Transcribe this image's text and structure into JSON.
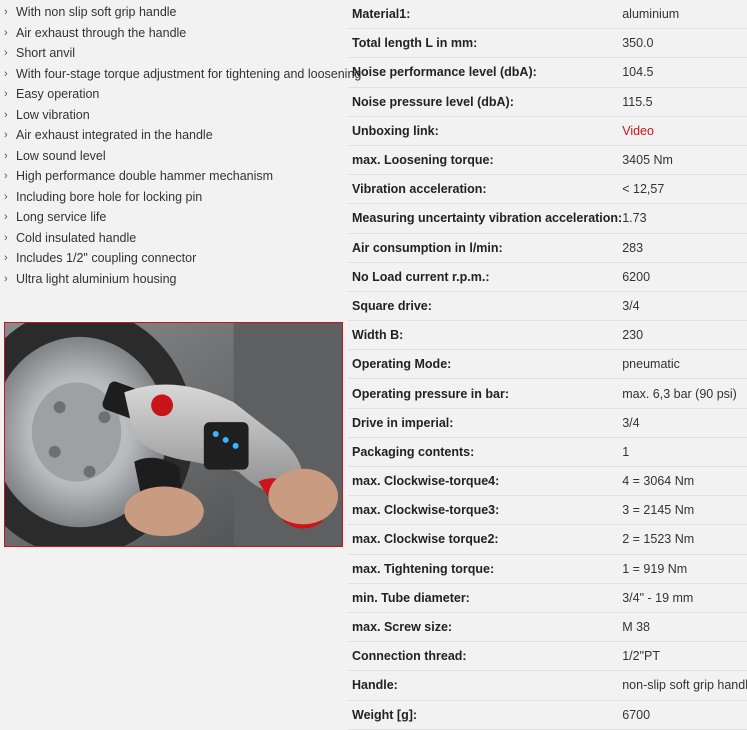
{
  "features": [
    "With non slip soft grip handle",
    "Air exhaust through the handle",
    "Short anvil",
    "With four-stage torque adjustment for tightening and loosening",
    "Easy operation",
    "Low vibration",
    "Air exhaust integrated in the handle",
    "Low sound level",
    "High performance double hammer mechanism",
    "Including bore hole for locking pin",
    "Long service life",
    "Cold insulated handle",
    "Includes 1/2\" coupling connector",
    "Ultra light aluminium housing"
  ],
  "specs": [
    {
      "label": "Material1:",
      "value": "aluminium"
    },
    {
      "label": "Total length L in mm:",
      "value": "350.0"
    },
    {
      "label": "Noise performance level (dbA):",
      "value": "104.5"
    },
    {
      "label": "Noise pressure level (dbA):",
      "value": "115.5"
    },
    {
      "label": "Unboxing link:",
      "value": "Video"
    },
    {
      "label": "max. Loosening torque:",
      "value": "3405 Nm"
    },
    {
      "label": "Vibration acceleration:",
      "value": "< 12,57"
    },
    {
      "label": "Measuring uncertainty vibration acceleration:",
      "value": "1.73"
    },
    {
      "label": "Air consumption in l/min:",
      "value": "283"
    },
    {
      "label": "No Load current r.p.m.:",
      "value": "6200"
    },
    {
      "label": "Square drive:",
      "value": "3/4"
    },
    {
      "label": "Width B:",
      "value": "230"
    },
    {
      "label": "Operating Mode:",
      "value": "pneumatic"
    },
    {
      "label": "Operating pressure in bar:",
      "value": "max. 6,3 bar (90 psi)"
    },
    {
      "label": "Drive in imperial:",
      "value": "3/4"
    },
    {
      "label": "Packaging contents:",
      "value": "1"
    },
    {
      "label": "max. Clockwise-torque4:",
      "value": "4 = 3064 Nm"
    },
    {
      "label": "max. Clockwise-torque3:",
      "value": "3 = 2145 Nm"
    },
    {
      "label": "max. Clockwise torque2:",
      "value": "2 = 1523 Nm"
    },
    {
      "label": "max. Tightening torque:",
      "value": "1 = 919 Nm"
    },
    {
      "label": "min. Tube diameter:",
      "value": "3/4\" - 19 mm"
    },
    {
      "label": "max. Screw size:",
      "value": "M 38"
    },
    {
      "label": "Connection thread:",
      "value": "1/2\"PT"
    },
    {
      "label": "Handle:",
      "value": "non-slip soft grip handle"
    },
    {
      "label": "Weight [g]:",
      "value": "6700"
    }
  ],
  "colors": {
    "link": "#c9141a",
    "photo_border": "#c9141a",
    "background": "#f2f2f2"
  },
  "icons": {
    "bullet": "chevron-right-icon"
  }
}
